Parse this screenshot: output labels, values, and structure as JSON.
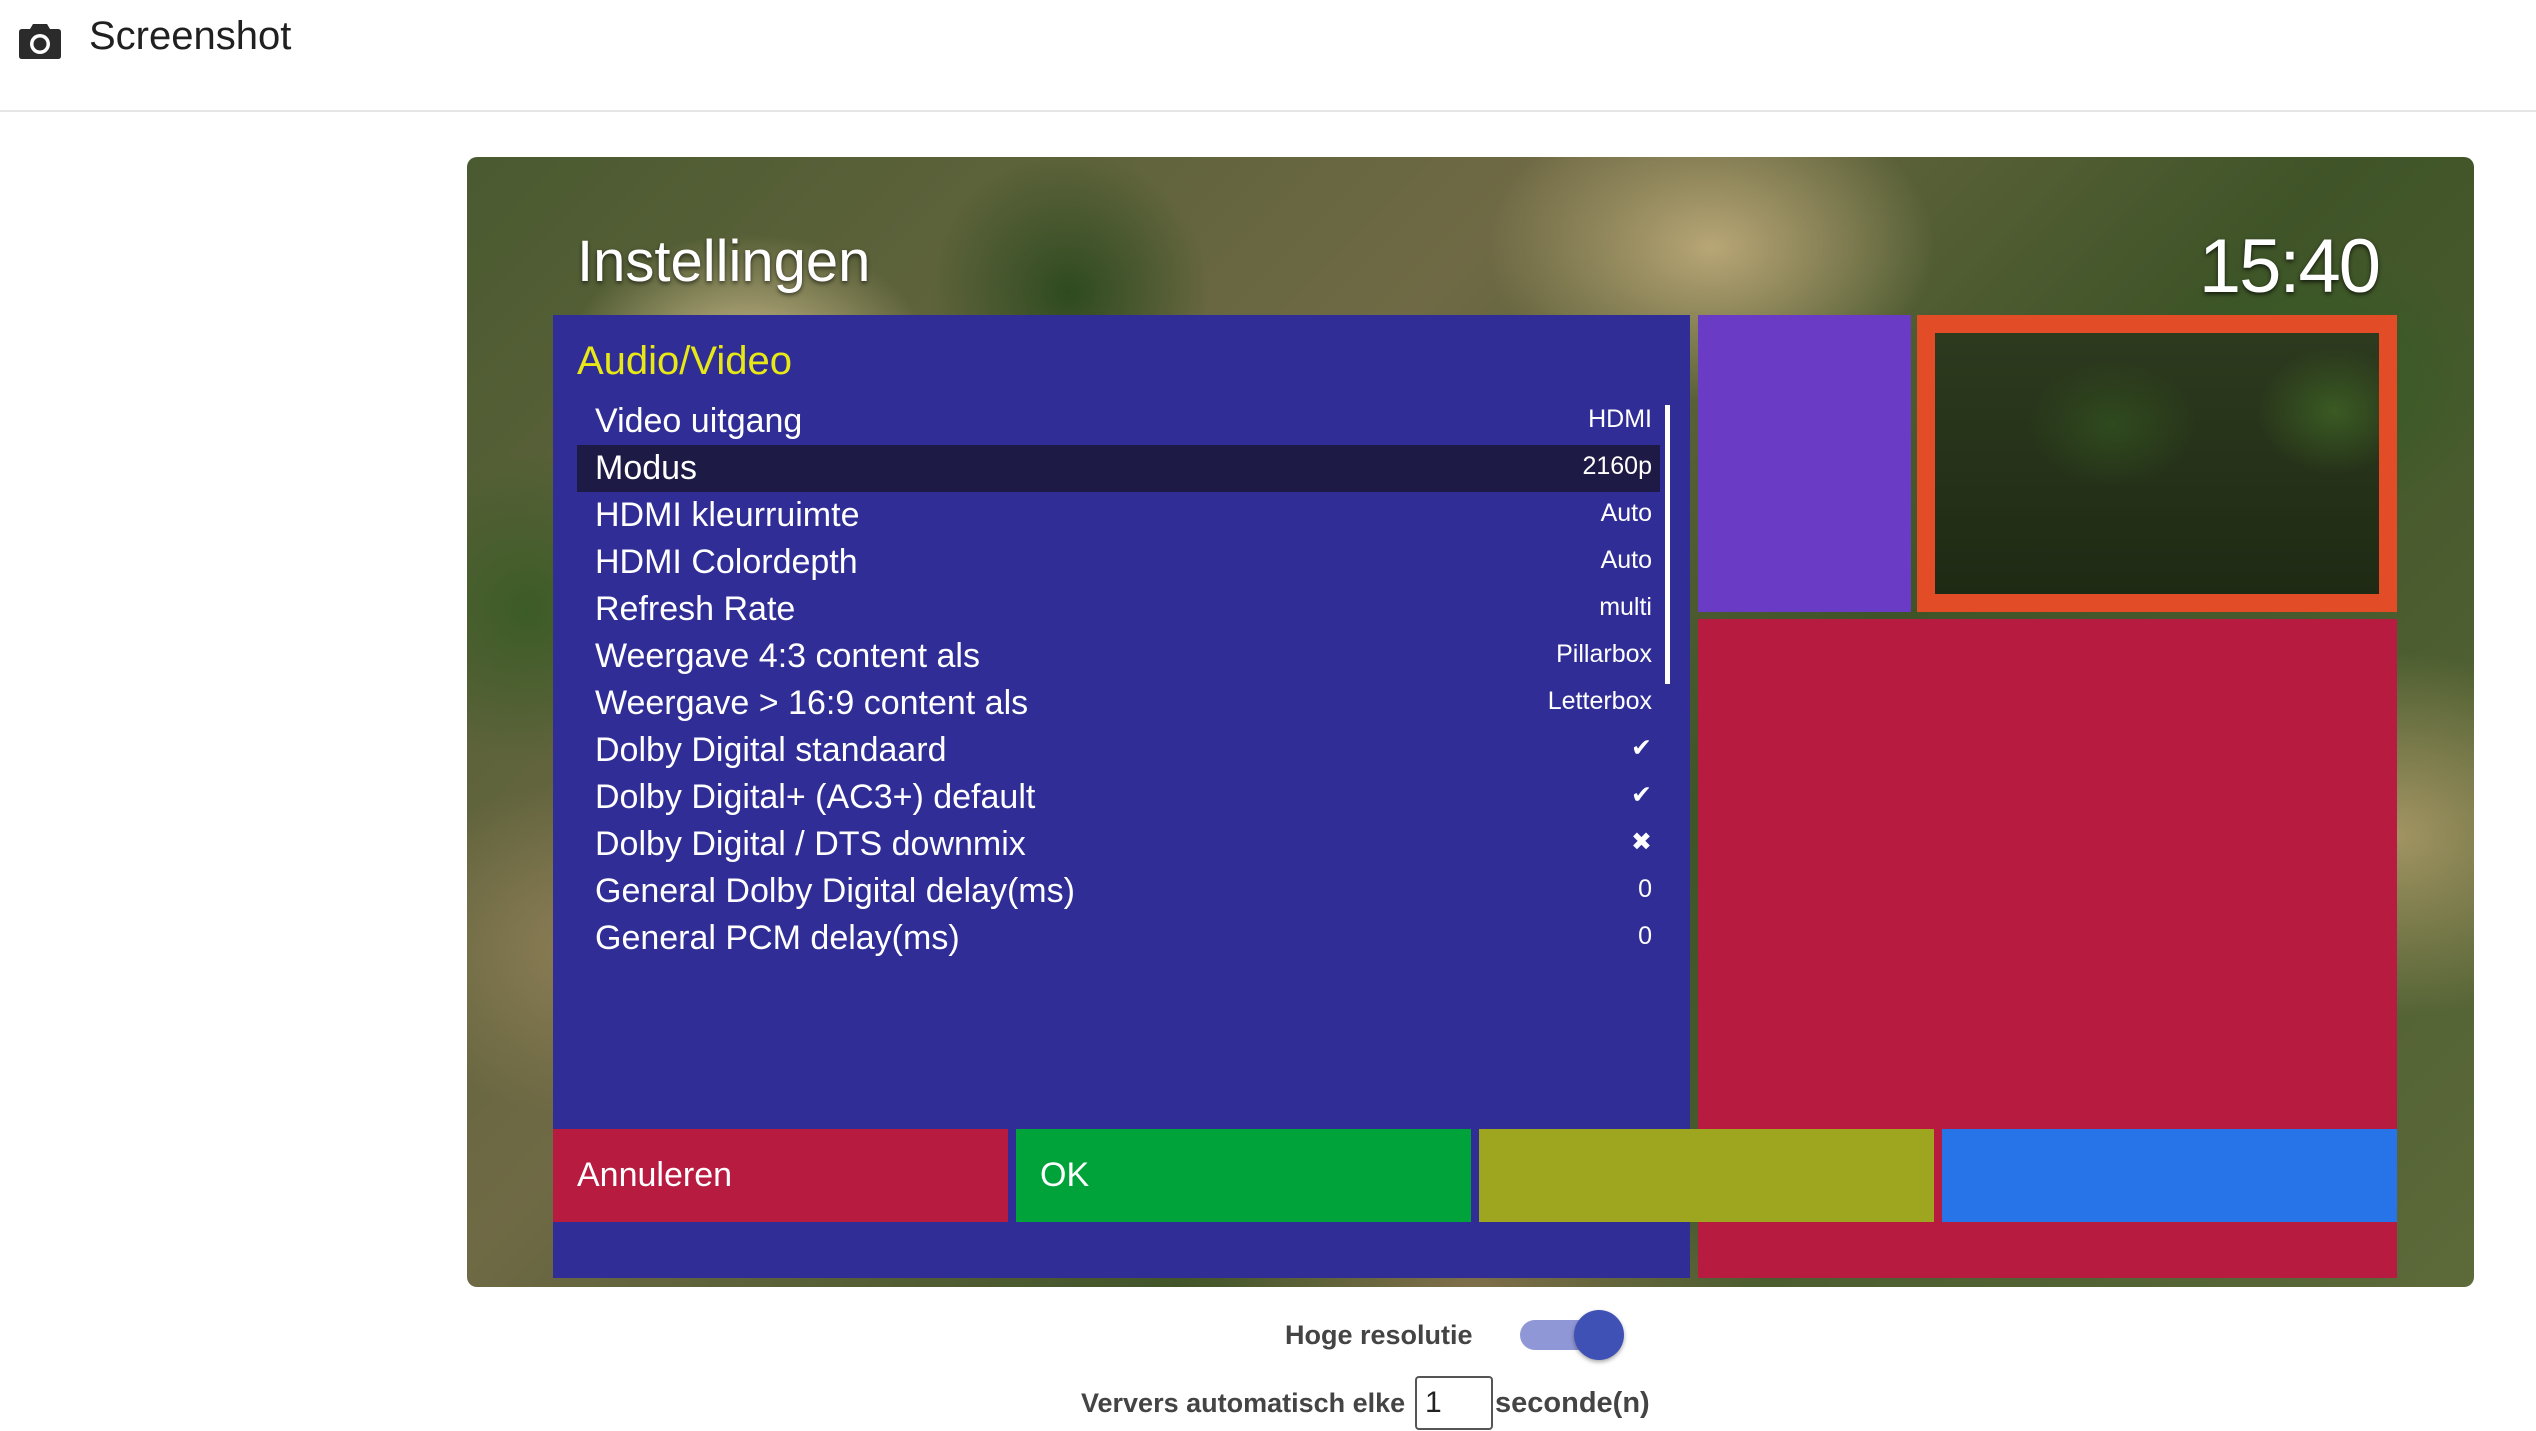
{
  "header": {
    "title": "Screenshot",
    "icon": "camera-icon"
  },
  "tv": {
    "title": "Instellingen",
    "clock": "15:40",
    "section": "Audio/Video",
    "items": [
      {
        "label": "Video uitgang",
        "value": "HDMI"
      },
      {
        "label": "Modus",
        "value": "2160p",
        "selected": true
      },
      {
        "label": "HDMI kleurruimte",
        "value": "Auto"
      },
      {
        "label": "HDMI Colordepth",
        "value": "Auto"
      },
      {
        "label": "Refresh Rate",
        "value": "multi"
      },
      {
        "label": "Weergave 4:3 content als",
        "value": "Pillarbox"
      },
      {
        "label": "Weergave > 16:9 content als",
        "value": "Letterbox"
      },
      {
        "label": "Dolby Digital standaard",
        "value": "✔"
      },
      {
        "label": "Dolby Digital+ (AC3+) default",
        "value": "✔"
      },
      {
        "label": "Dolby Digital / DTS downmix",
        "value": "✖"
      },
      {
        "label": "General Dolby Digital delay(ms)",
        "value": "0"
      },
      {
        "label": "General PCM delay(ms)",
        "value": "0"
      }
    ],
    "buttons": {
      "red": "Annuleren",
      "green": "OK",
      "yellow": "",
      "blue": ""
    },
    "colors": {
      "panel": "#302e96",
      "section_title": "#e8e816",
      "red": "#b81b40",
      "green": "#00a33a",
      "yellow": "#9ea61f",
      "blue": "#2773e8",
      "purple": "#6a3cc6",
      "orange": "#e24d28"
    }
  },
  "controls": {
    "high_res_label": "Hoge resolutie",
    "high_res_on": true,
    "refresh_label": "Ververs automatisch elke",
    "refresh_value": "1",
    "refresh_unit": "seconde(n)"
  }
}
